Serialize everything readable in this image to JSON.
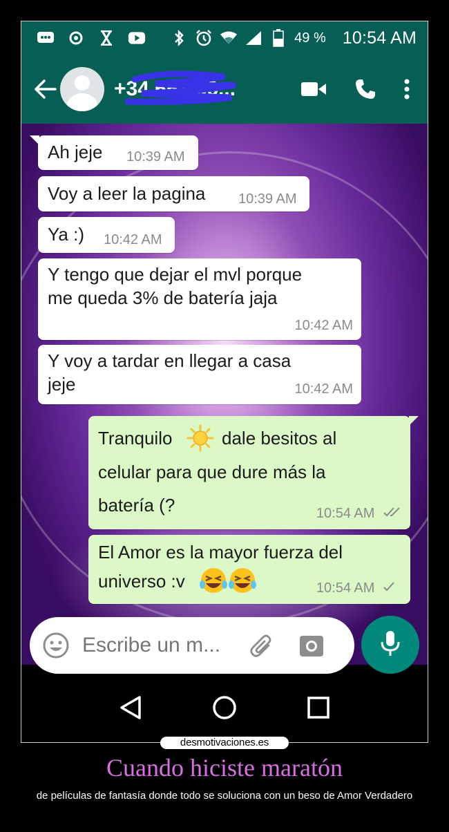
{
  "status_bar": {
    "battery_text": "49 %",
    "time": "10:54 AM",
    "left_icons": [
      "message-icon",
      "record-icon",
      "hourglass-icon",
      "youtube-icon"
    ],
    "right_icons": [
      "bluetooth-icon",
      "alarm-icon",
      "wifi-icon",
      "signal-icon",
      "battery-icon"
    ]
  },
  "header": {
    "contact_name": "+34 651 56...",
    "colors": {
      "primary": "#075e54"
    }
  },
  "messages": [
    {
      "direction": "in",
      "text": "Ah jeje",
      "time": "10:39 AM"
    },
    {
      "direction": "in",
      "text": "Voy a leer la pagina",
      "time": "10:39 AM"
    },
    {
      "direction": "in",
      "text": "Ya :)",
      "time": "10:42 AM"
    },
    {
      "direction": "in",
      "text_line1": "Y tengo que dejar el mvl porque",
      "text_line2": "me queda 3% de batería jaja",
      "time": "10:42 AM"
    },
    {
      "direction": "in",
      "text_line1": "Y voy a tardar en llegar a casa",
      "text_line2": "jeje",
      "time": "10:42 AM"
    },
    {
      "direction": "out",
      "text_a": "Tranquilo",
      "text_b": "dale besitos al",
      "text_line2": "celular para que dure más la",
      "text_line3": "batería (?",
      "time": "10:54 AM",
      "status": "read"
    },
    {
      "direction": "out",
      "text_line1": "El Amor es la mayor fuerza del",
      "text_line2": "universo :v",
      "time": "10:54 AM",
      "status": "sent"
    }
  ],
  "input": {
    "placeholder": "Escribe un m..."
  },
  "caption": {
    "site": "desmotivaciones.es",
    "title": "Cuando hiciste maratón",
    "subtitle": "de películas de fantasía donde todo se soluciona con un beso de Amor Verdadero"
  },
  "colors": {
    "incoming_bubble": "#ffffff",
    "outgoing_bubble": "#dcf8c6",
    "mic_button": "#00897b",
    "caption_title": "#d770e0"
  }
}
